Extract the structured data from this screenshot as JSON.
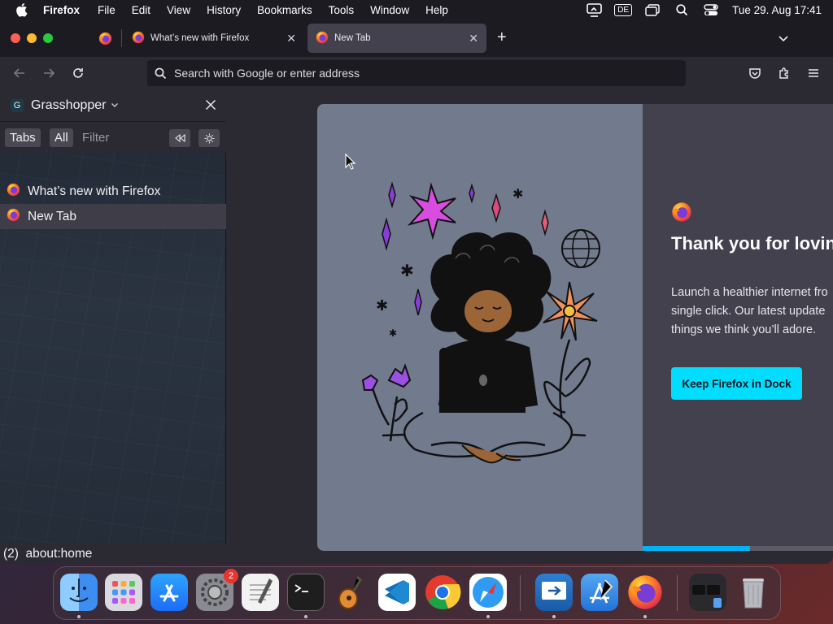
{
  "menubar": {
    "app": "Firefox",
    "items": [
      "File",
      "Edit",
      "View",
      "History",
      "Bookmarks",
      "Tools",
      "Window",
      "Help"
    ],
    "input_source": "DE",
    "clock": "Tue 29. Aug  17:41"
  },
  "tabs": [
    {
      "title": "What’s new with Firefox",
      "active": false
    },
    {
      "title": "New Tab",
      "active": true
    }
  ],
  "urlbar": {
    "placeholder": "Search with Google or enter address"
  },
  "sidebar": {
    "logo_letter": "G",
    "title": "Grasshopper",
    "filter_tabs": [
      "Tabs",
      "All",
      "Filter"
    ],
    "tab_list": [
      "What’s new with Firefox",
      "New Tab"
    ],
    "status": "(2)  about:home"
  },
  "newtab_card": {
    "title": "Thank you for loving",
    "description": "Launch a healthier internet fro\nsingle click. Our latest update\nthings we think you’ll adore.",
    "button": "Keep Firefox in Dock",
    "progress": 0.55
  },
  "dock": {
    "apps": [
      "finder-icon",
      "launchpad-icon",
      "app-store-icon",
      "system-settings-icon",
      "textedit-icon",
      "terminal-icon",
      "garageband-icon",
      "vscode-icon",
      "chrome-icon",
      "safari-icon",
      "screen-sharing-icon",
      "xcode-icon",
      "firefox-icon",
      "downloads-folder-icon",
      "trash-icon"
    ],
    "settings_badge": "2"
  }
}
